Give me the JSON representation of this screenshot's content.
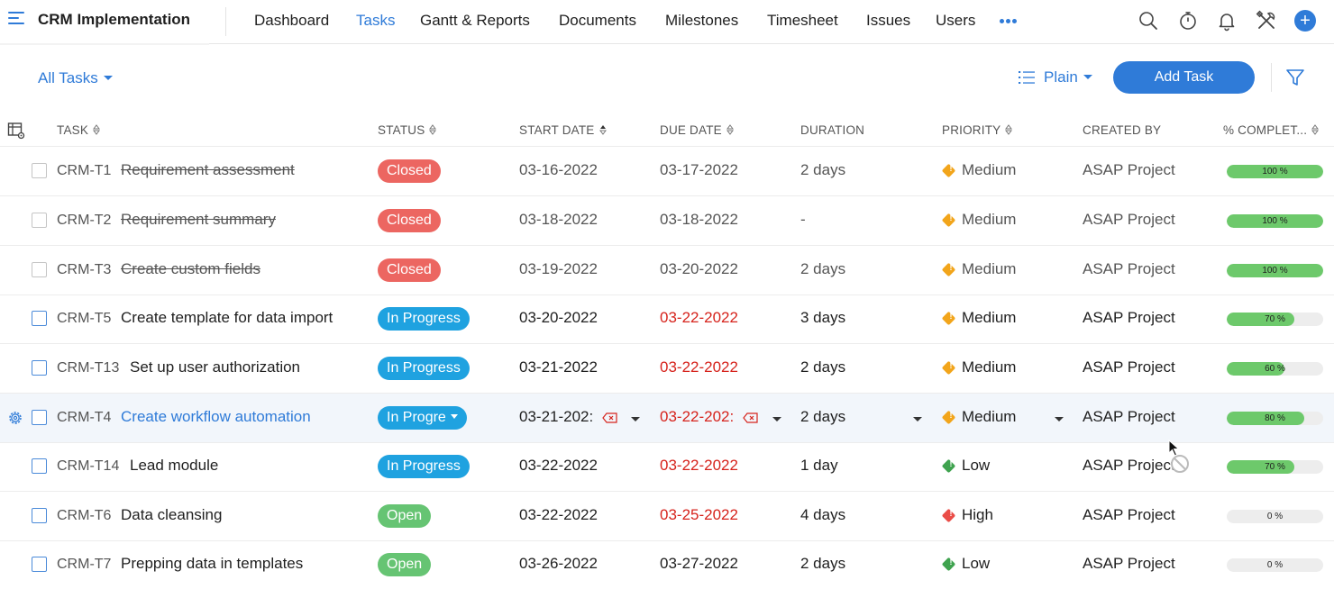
{
  "header": {
    "project_title": "CRM Implementation",
    "nav": [
      {
        "label": "Dashboard",
        "active": false
      },
      {
        "label": "Tasks",
        "active": true
      },
      {
        "label": "Gantt & Reports",
        "active": false
      },
      {
        "label": "Documents",
        "active": false
      },
      {
        "label": "Milestones",
        "active": false
      },
      {
        "label": "Timesheet",
        "active": false
      },
      {
        "label": "Issues",
        "active": false
      },
      {
        "label": "Users",
        "active": false
      }
    ],
    "icons": [
      "more-dots-icon",
      "search-icon",
      "timer-icon",
      "bell-icon",
      "tools-icon",
      "add-icon"
    ],
    "accent_color": "#2f7bd8"
  },
  "toolbar": {
    "filter_label": "All Tasks",
    "view_label": "Plain",
    "add_task_label": "Add Task"
  },
  "columns": {
    "task": "TASK",
    "status": "STATUS",
    "start_date": "START DATE",
    "due_date": "DUE DATE",
    "duration": "DURATION",
    "priority": "PRIORITY",
    "created_by": "CREATED BY",
    "percent_complete": "% COMPLET..."
  },
  "tasks": [
    {
      "id": "CRM-T1",
      "name": "Requirement assessment",
      "status": "Closed",
      "start": "03-16-2022",
      "due": "03-17-2022",
      "duration": "2 days",
      "priority": "Medium",
      "created_by": "ASAP Project",
      "percent": 100,
      "percent_label": "100 %"
    },
    {
      "id": "CRM-T2",
      "name": "Requirement summary",
      "status": "Closed",
      "start": "03-18-2022",
      "due": "03-18-2022",
      "duration": "-",
      "priority": "Medium",
      "created_by": "ASAP Project",
      "percent": 100,
      "percent_label": "100 %"
    },
    {
      "id": "CRM-T3",
      "name": "Create custom fields",
      "status": "Closed",
      "start": "03-19-2022",
      "due": "03-20-2022",
      "duration": "2 days",
      "priority": "Medium",
      "created_by": "ASAP Project",
      "percent": 100,
      "percent_label": "100 %"
    },
    {
      "id": "CRM-T5",
      "name": "Create template for data import",
      "status": "In Progress",
      "start": "03-20-2022",
      "due": "03-22-2022",
      "duration": "3 days",
      "priority": "Medium",
      "created_by": "ASAP Project",
      "percent": 70,
      "percent_label": "70 %"
    },
    {
      "id": "CRM-T13",
      "name": "Set up user authorization",
      "status": "In Progress",
      "start": "03-21-2022",
      "due": "03-22-2022",
      "duration": "2 days",
      "priority": "Medium",
      "created_by": "ASAP Project",
      "percent": 60,
      "percent_label": "60 %"
    },
    {
      "id": "CRM-T4",
      "name": "Create workflow automation",
      "status": "In Progre",
      "start": "03-21-202:",
      "due": "03-22-202:",
      "duration": "2 days",
      "priority": "Medium",
      "created_by": "ASAP Project",
      "percent": 80,
      "percent_label": "80 %"
    },
    {
      "id": "CRM-T14",
      "name": "Lead module",
      "status": "In Progress",
      "start": "03-22-2022",
      "due": "03-22-2022",
      "duration": "1 day",
      "priority": "Low",
      "created_by": "ASAP Project",
      "percent": 70,
      "percent_label": "70 %"
    },
    {
      "id": "CRM-T6",
      "name": "Data cleansing",
      "status": "Open",
      "start": "03-22-2022",
      "due": "03-25-2022",
      "duration": "4 days",
      "priority": "High",
      "created_by": "ASAP Project",
      "percent": 0,
      "percent_label": "0 %"
    },
    {
      "id": "CRM-T7",
      "name": "Prepping data in templates",
      "status": "Open",
      "start": "03-26-2022",
      "due": "03-27-2022",
      "duration": "2 days",
      "priority": "Low",
      "created_by": "ASAP Project",
      "percent": 0,
      "percent_label": "0 %"
    }
  ],
  "status_colors": {
    "Closed": "#ec6661",
    "In Progress": "#1fa2e0",
    "Open": "#66c473"
  },
  "priority_colors": {
    "Medium": "#f2a51b",
    "Low": "#3fa34f",
    "High": "#ea4d47"
  },
  "overdue_color": "#d6231c"
}
